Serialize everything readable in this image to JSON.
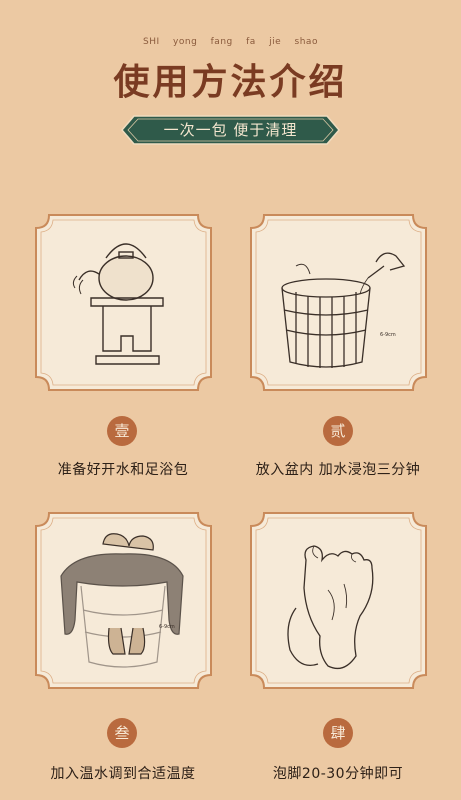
{
  "header": {
    "pinyin": "SHI yong fang fa jie shao",
    "title": "使用方法介绍",
    "badge": "一次一包 便于清理"
  },
  "steps": [
    {
      "number": "壹",
      "caption": "准备好开水和足浴包",
      "illustration": "kettle-on-stove-icon"
    },
    {
      "number": "贰",
      "caption": "放入盆内 加水浸泡三分钟",
      "illustration": "wooden-bucket-icon"
    },
    {
      "number": "叁",
      "caption": "加入温水调到合适温度",
      "illustration": "foot-soak-icon"
    },
    {
      "number": "肆",
      "caption": "泡脚20-30分钟即可",
      "illustration": "feet-icon"
    }
  ],
  "colors": {
    "background": "#ecc9a3",
    "card": "#f6ead8",
    "frame": "#c98a5a",
    "badge": "#2f5a4a",
    "number": "#b96a3e",
    "title": "#7a3b22"
  }
}
